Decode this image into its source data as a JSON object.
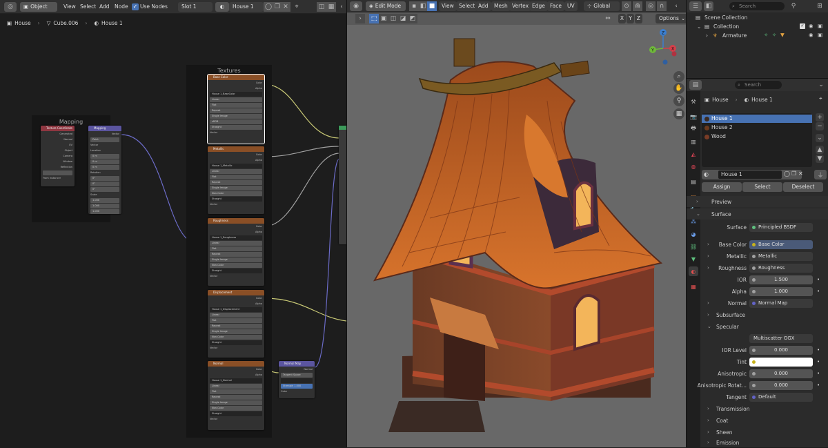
{
  "node_header": {
    "mode": "Object",
    "menus": [
      "View",
      "Select",
      "Add",
      "Node"
    ],
    "use_nodes": "Use Nodes",
    "slot": "Slot 1",
    "material": "House 1"
  },
  "breadcrumb": {
    "object": "House",
    "mesh": "Cube.006",
    "material": "House 1"
  },
  "nodes": {
    "mapping_frame": "Mapping",
    "textures_frame": "Textures",
    "tex_coord": "Texture Coordinate",
    "mapping": "Mapping",
    "base_color": "Base Color",
    "metallic": "Metallic",
    "roughness": "Roughness",
    "displacement": "Displacement",
    "normal": "Normal",
    "normal_map": "Normal Map",
    "img_base": "House 1_BaseColor",
    "img_metal": "House 1_Metallic",
    "img_rough": "House 1_Roughness",
    "img_disp": "House 1_Displacement",
    "img_norm": "House 1_Normal",
    "linear": "Linear",
    "flat": "Flat",
    "repeat": "Repeat",
    "single": "Single Image",
    "colorspace": "Color Space",
    "srgb": "sRGB",
    "noncolor": "Non-Color",
    "alpha": "Alpha",
    "straight": "Straight",
    "color_out": "Color",
    "alpha_out": "Alpha",
    "vector": "Vector",
    "type": "Type",
    "point": "Point",
    "location": "Location",
    "rotation": "Rotation",
    "scale": "Scale",
    "tangent_space": "Tangent Space",
    "strength": "Strength",
    "strength_val": "1.000",
    "generated": "Generated",
    "normal_sock": "Normal",
    "uv": "UV",
    "object": "Object",
    "camera": "Camera",
    "window": "Window",
    "reflection": "Reflection",
    "from_instancer": "From Instancer",
    "zero": "0 m",
    "zero_deg": "0°",
    "one": "1.000"
  },
  "viewport_header": {
    "mode": "Edit Mode",
    "menus": [
      "View",
      "Select",
      "Add",
      "Mesh",
      "Vertex",
      "Edge",
      "Face",
      "UV"
    ],
    "orientation": "Global",
    "options": "Options",
    "axes": [
      "X",
      "Y",
      "Z"
    ],
    "gizmo": {
      "z": "Z",
      "y": "Y",
      "x": "X"
    }
  },
  "outliner": {
    "search_placeholder": "Search",
    "root": "Scene Collection",
    "collection": "Collection",
    "armature": "Armature"
  },
  "properties": {
    "search_placeholder": "Search",
    "breadcrumb_object": "House",
    "breadcrumb_material": "House 1",
    "slots": [
      "House 1",
      "House 2",
      "Wood"
    ],
    "slot_colors": [
      "#3c2a20",
      "#6b3a1e",
      "#7a3c26"
    ],
    "material_name": "House 1",
    "assign": "Assign",
    "select": "Select",
    "deselect": "Deselect",
    "preview": "Preview",
    "surface_section": "Surface",
    "surface_label": "Surface",
    "surface_value": "Principled BSDF",
    "rows": [
      {
        "label": "Base Color",
        "value": "Base Color",
        "dot": "#c7b21c",
        "expand": true,
        "highlight": true
      },
      {
        "label": "Metallic",
        "value": "Metallic",
        "dot": "#a1a1a1",
        "expand": true
      },
      {
        "label": "Roughness",
        "value": "Roughness",
        "dot": "#a1a1a1",
        "expand": true
      },
      {
        "label": "IOR",
        "value": "1.500",
        "num": true
      },
      {
        "label": "Alpha",
        "value": "1.000",
        "num": true
      },
      {
        "label": "Normal",
        "value": "Normal Map",
        "dot": "#6363c7",
        "expand": true
      }
    ],
    "subsurface": "Subsurface",
    "specular": "Specular",
    "spec_dist": "Multiscatter GGX",
    "ior_level_label": "IOR Level",
    "ior_level": "0.000",
    "tint_label": "Tint",
    "anisotropic_label": "Anisotropic",
    "anisotropic": "0.000",
    "aniso_rot_label": "Anisotropic Rotat...",
    "aniso_rot": "0.000",
    "tangent_label": "Tangent",
    "tangent": "Default",
    "transmission": "Transmission",
    "coat": "Coat",
    "sheen": "Sheen",
    "emission": "Emission"
  },
  "colors": {
    "accent_blue": "#4772b3",
    "node_texture_header": "#8a4f26",
    "node_vector_header": "#5b55a0",
    "node_input_header": "#8f3741",
    "link_yellow": "#c7c775",
    "link_purple": "#6b6bc7",
    "link_grey": "#a1a1a1"
  }
}
